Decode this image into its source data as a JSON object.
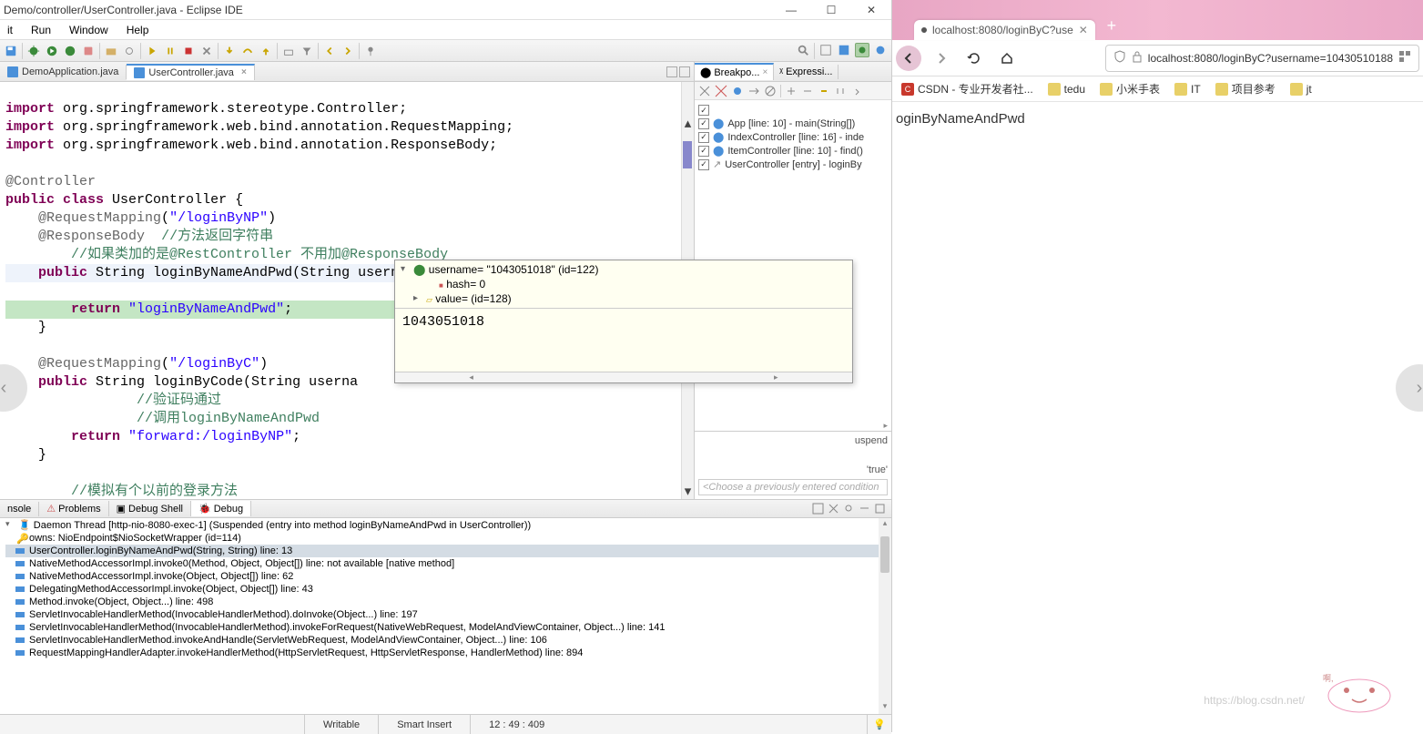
{
  "eclipse": {
    "title": "Demo/controller/UserController.java - Eclipse IDE",
    "menus": [
      "it",
      "Run",
      "Window",
      "Help"
    ],
    "tabs": {
      "inactive": "DemoApplication.java",
      "active": "UserController.java"
    },
    "code_lines": {
      "l1": {
        "t": "import org.springframework.stereotype.Controller;"
      },
      "l2": {
        "t": "import org.springframework.web.bind.annotation.RequestMapping;"
      },
      "l3": {
        "t": "import org.springframework.web.bind.annotation.ResponseBody;"
      },
      "ann1": "@Controller",
      "cls": "public class UserController {",
      "rm1": "    @RequestMapping(\"/loginByNP\")",
      "rm1_str": "\"/loginByNP\"",
      "rb": "    @ResponseBody  //方法返回字符串",
      "rb_cmt": "//方法返回字符串",
      "c1": "    //如果类加的是@RestController 不用加@ResponseBody",
      "m1": "    public String loginByNameAndPwd(String username,String pwd) {",
      "ret1": "        return \"loginByNameAndPwd\";",
      "ret1_str": "\"loginByNameAndPwd\"",
      "close1": "    }",
      "rm2": "    @RequestMapping(\"/loginByC\")",
      "rm2_str": "\"/loginByC\"",
      "m2": "    public String loginByCode(String userna",
      "c2": "        //验证码通过",
      "c3": "        //调用loginByNameAndPwd",
      "ret2": "        return \"forward:/loginByNP\";",
      "ret2_str": "\"forward:/loginByNP\"",
      "close2": "    }",
      "c4": "    //模拟有个以前的登录方法"
    },
    "tooltip": {
      "root": "username= \"1043051018\" (id=122)",
      "hash": "hash= 0",
      "value": "value= (id=128)",
      "display": "1043051018"
    },
    "right_panel": {
      "tab1": "Breakpo...",
      "tab2": "Expressi...",
      "items": [
        "App [line: 10] - main(String[])",
        "IndexController [line: 16] - inde",
        "ItemController [line: 10] - find()",
        "UserController [entry] - loginBy"
      ],
      "suspend": "uspend",
      "true": "'true'",
      "cond_placeholder": "<Choose a previously entered condition"
    },
    "bottom_tabs": [
      "nsole",
      "Problems",
      "Debug Shell",
      "Debug"
    ],
    "stack": {
      "thread": "Daemon Thread [http-nio-8080-exec-1] (Suspended (entry into method loginByNameAndPwd in UserController))",
      "owns": "owns: NioEndpoint$NioSocketWrapper  (id=114)",
      "frames": [
        "UserController.loginByNameAndPwd(String, String) line: 13",
        "NativeMethodAccessorImpl.invoke0(Method, Object, Object[]) line: not available [native method]",
        "NativeMethodAccessorImpl.invoke(Object, Object[]) line: 62",
        "DelegatingMethodAccessorImpl.invoke(Object, Object[]) line: 43",
        "Method.invoke(Object, Object...) line: 498",
        "ServletInvocableHandlerMethod(InvocableHandlerMethod).doInvoke(Object...) line: 197",
        "ServletInvocableHandlerMethod(InvocableHandlerMethod).invokeForRequest(NativeWebRequest, ModelAndViewContainer, Object...) line: 141",
        "ServletInvocableHandlerMethod.invokeAndHandle(ServletWebRequest, ModelAndViewContainer, Object...) line: 106",
        "RequestMappingHandlerAdapter.invokeHandlerMethod(HttpServletRequest, HttpServletResponse, HandlerMethod) line: 894"
      ]
    },
    "status": {
      "writable": "Writable",
      "insert": "Smart Insert",
      "pos": "12 : 49 : 409"
    }
  },
  "browser": {
    "tab_title": "localhost:8080/loginByC?use",
    "url": "localhost:8080/loginByC?username=10430510188",
    "bookmarks": [
      {
        "label": "CSDN - 专业开发者社...",
        "color": "#c8382c"
      },
      {
        "label": "tedu",
        "color": "#e8d068"
      },
      {
        "label": "小米手表",
        "color": "#e8d068"
      },
      {
        "label": "IT",
        "color": "#e8d068"
      },
      {
        "label": "项目参考",
        "color": "#e8d068"
      },
      {
        "label": "jt",
        "color": "#e8d068"
      }
    ],
    "page_text": "oginByNameAndPwd"
  },
  "watermark": "https://blog.csdn.net/"
}
